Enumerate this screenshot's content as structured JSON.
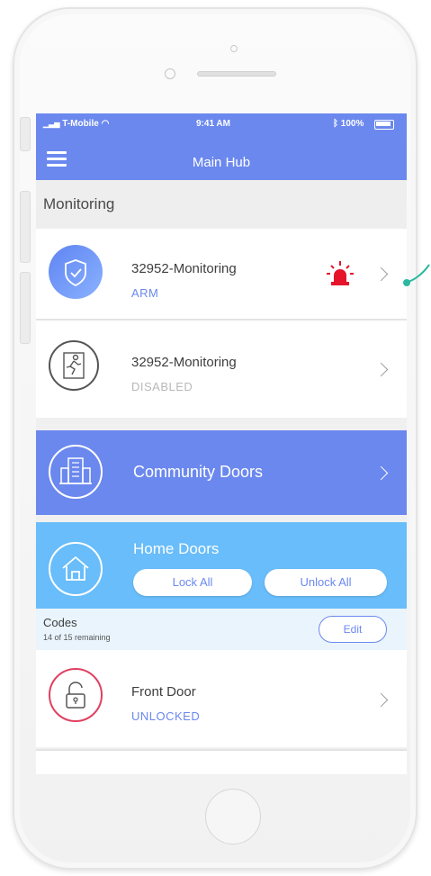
{
  "status_bar": {
    "carrier": "T-Mobile",
    "time": "9:41 AM",
    "battery": "100%"
  },
  "header": {
    "title": "Main Hub"
  },
  "section": {
    "title": "Monitoring"
  },
  "monitoring_rows": [
    {
      "name": "32952-Monitoring",
      "status": "ARM",
      "status_color": "#6b88ee"
    },
    {
      "name": "32952-Monitoring",
      "status": "DISABLED",
      "status_color": "#b8b8b8"
    }
  ],
  "community": {
    "label": "Community Doors",
    "bg_color": "#6b88ee"
  },
  "home": {
    "label": "Home Doors",
    "bg_color": "#68bdfa",
    "lock_all": "Lock All",
    "unlock_all": "Unlock All"
  },
  "codes": {
    "title": "Codes",
    "subtitle": "14 of 15 remaining",
    "edit": "Edit"
  },
  "door": {
    "name": "Front Door",
    "status": "UNLOCKED",
    "accent": "#e0405f"
  },
  "colors": {
    "alarm": "#e5142b",
    "pointer": "#2bb9a0"
  }
}
